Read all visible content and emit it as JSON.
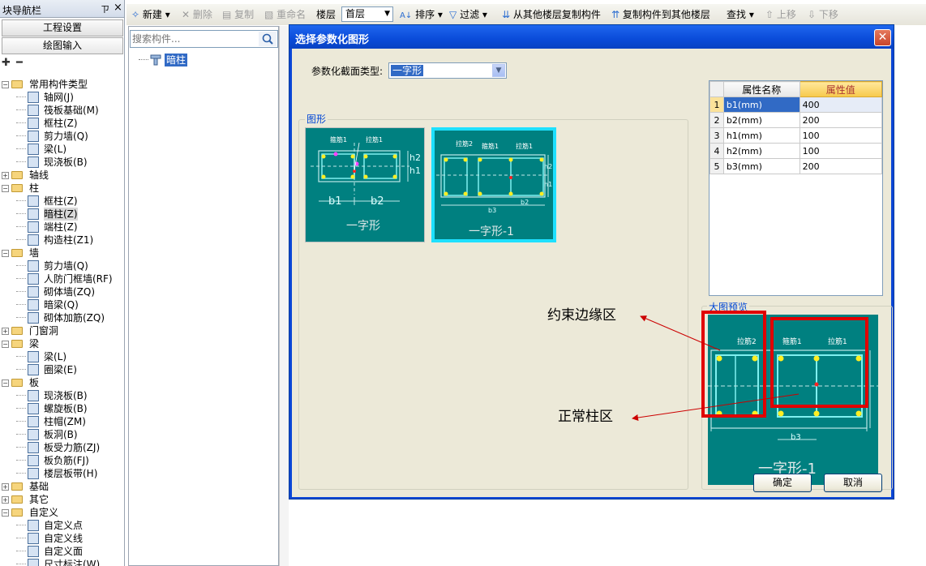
{
  "nav": {
    "title": "块导航栏",
    "pin": "ㄗ",
    "close": "×",
    "buttons": [
      "工程设置",
      "绘图输入"
    ],
    "toolbar_icons": [
      "add-icon",
      "remove-icon"
    ],
    "tree": [
      {
        "label": "常用构件类型",
        "level": 0,
        "expanded": true,
        "folder": true
      },
      {
        "label": "轴网(J)",
        "level": 1
      },
      {
        "label": "筏板基础(M)",
        "level": 1
      },
      {
        "label": "框柱(Z)",
        "level": 1
      },
      {
        "label": "剪力墙(Q)",
        "level": 1
      },
      {
        "label": "梁(L)",
        "level": 1
      },
      {
        "label": "现浇板(B)",
        "level": 1
      },
      {
        "label": "轴线",
        "level": 0,
        "expanded": false,
        "folder": true
      },
      {
        "label": "柱",
        "level": 0,
        "expanded": true,
        "folder": true
      },
      {
        "label": "框柱(Z)",
        "level": 1
      },
      {
        "label": "暗柱(Z)",
        "level": 1,
        "selected": true
      },
      {
        "label": "端柱(Z)",
        "level": 1
      },
      {
        "label": "构造柱(Z1)",
        "level": 1
      },
      {
        "label": "墙",
        "level": 0,
        "expanded": true,
        "folder": true
      },
      {
        "label": "剪力墙(Q)",
        "level": 1
      },
      {
        "label": "人防门框墙(RF)",
        "level": 1
      },
      {
        "label": "砌体墙(ZQ)",
        "level": 1
      },
      {
        "label": "暗梁(Q)",
        "level": 1
      },
      {
        "label": "砌体加筋(ZQ)",
        "level": 1
      },
      {
        "label": "门窗洞",
        "level": 0,
        "expanded": false,
        "folder": true
      },
      {
        "label": "梁",
        "level": 0,
        "expanded": true,
        "folder": true
      },
      {
        "label": "梁(L)",
        "level": 1
      },
      {
        "label": "圈梁(E)",
        "level": 1
      },
      {
        "label": "板",
        "level": 0,
        "expanded": true,
        "folder": true
      },
      {
        "label": "现浇板(B)",
        "level": 1
      },
      {
        "label": "螺旋板(B)",
        "level": 1
      },
      {
        "label": "柱帽(ZM)",
        "level": 1
      },
      {
        "label": "板洞(B)",
        "level": 1
      },
      {
        "label": "板受力筋(ZJ)",
        "level": 1
      },
      {
        "label": "板负筋(FJ)",
        "level": 1
      },
      {
        "label": "楼层板带(H)",
        "level": 1
      },
      {
        "label": "基础",
        "level": 0,
        "expanded": false,
        "folder": true
      },
      {
        "label": "其它",
        "level": 0,
        "expanded": false,
        "folder": true
      },
      {
        "label": "自定义",
        "level": 0,
        "expanded": true,
        "folder": true
      },
      {
        "label": "自定义点",
        "level": 1
      },
      {
        "label": "自定义线",
        "level": 1
      },
      {
        "label": "自定义面",
        "level": 1
      },
      {
        "label": "尺寸标注(W)",
        "level": 1
      }
    ]
  },
  "toolbar": {
    "new": "新建",
    "delete": "删除",
    "copy": "复制",
    "rename": "重命名",
    "floor_label": "楼层",
    "floor_value": "首层",
    "sort": "排序",
    "filter": "过滤",
    "copy_from": "从其他楼层复制构件",
    "copy_to": "复制构件到其他楼层",
    "find": "查找",
    "up": "上移",
    "down": "下移"
  },
  "component_list": {
    "search_placeholder": "搜索构件...",
    "items": [
      "暗柱"
    ]
  },
  "dialog": {
    "title": "选择参数化图形",
    "close": "✕",
    "type_label": "参数化截面类型:",
    "type_value": "一字形",
    "graph_caption": "图形",
    "thumbnails": [
      {
        "label": "一字形",
        "selected": false,
        "notes": [
          "箍筋1",
          "拉筋1",
          "b1",
          "b2",
          "h1",
          "h2"
        ]
      },
      {
        "label": "一字形-1",
        "selected": true,
        "notes": [
          "拉筋2",
          "箍筋1",
          "拉筋1",
          "h2",
          "h1",
          "b3",
          "b2"
        ]
      }
    ],
    "table": {
      "headers": [
        "属性名称",
        "属性值"
      ],
      "rows": [
        {
          "n": "1",
          "name": "b1(mm)",
          "value": "400"
        },
        {
          "n": "2",
          "name": "b2(mm)",
          "value": "200"
        },
        {
          "n": "3",
          "name": "h1(mm)",
          "value": "100"
        },
        {
          "n": "4",
          "name": "h2(mm)",
          "value": "100"
        },
        {
          "n": "5",
          "name": "b3(mm)",
          "value": "200"
        }
      ]
    },
    "preview_caption": "大图预览",
    "preview_label": "一字形-1",
    "preview_notes": [
      "拉筋2",
      "箍筋1",
      "拉筋1",
      "b3"
    ],
    "ok": "确定",
    "cancel": "取消"
  },
  "annotations": {
    "restraint_zone": "约束边缘区",
    "normal_zone": "正常柱区"
  },
  "colors": {
    "dialog_title": "#0a4bd9",
    "diagram_bg": "#008080",
    "highlight_box": "#e00000",
    "selected_blue": "#316ac5"
  }
}
